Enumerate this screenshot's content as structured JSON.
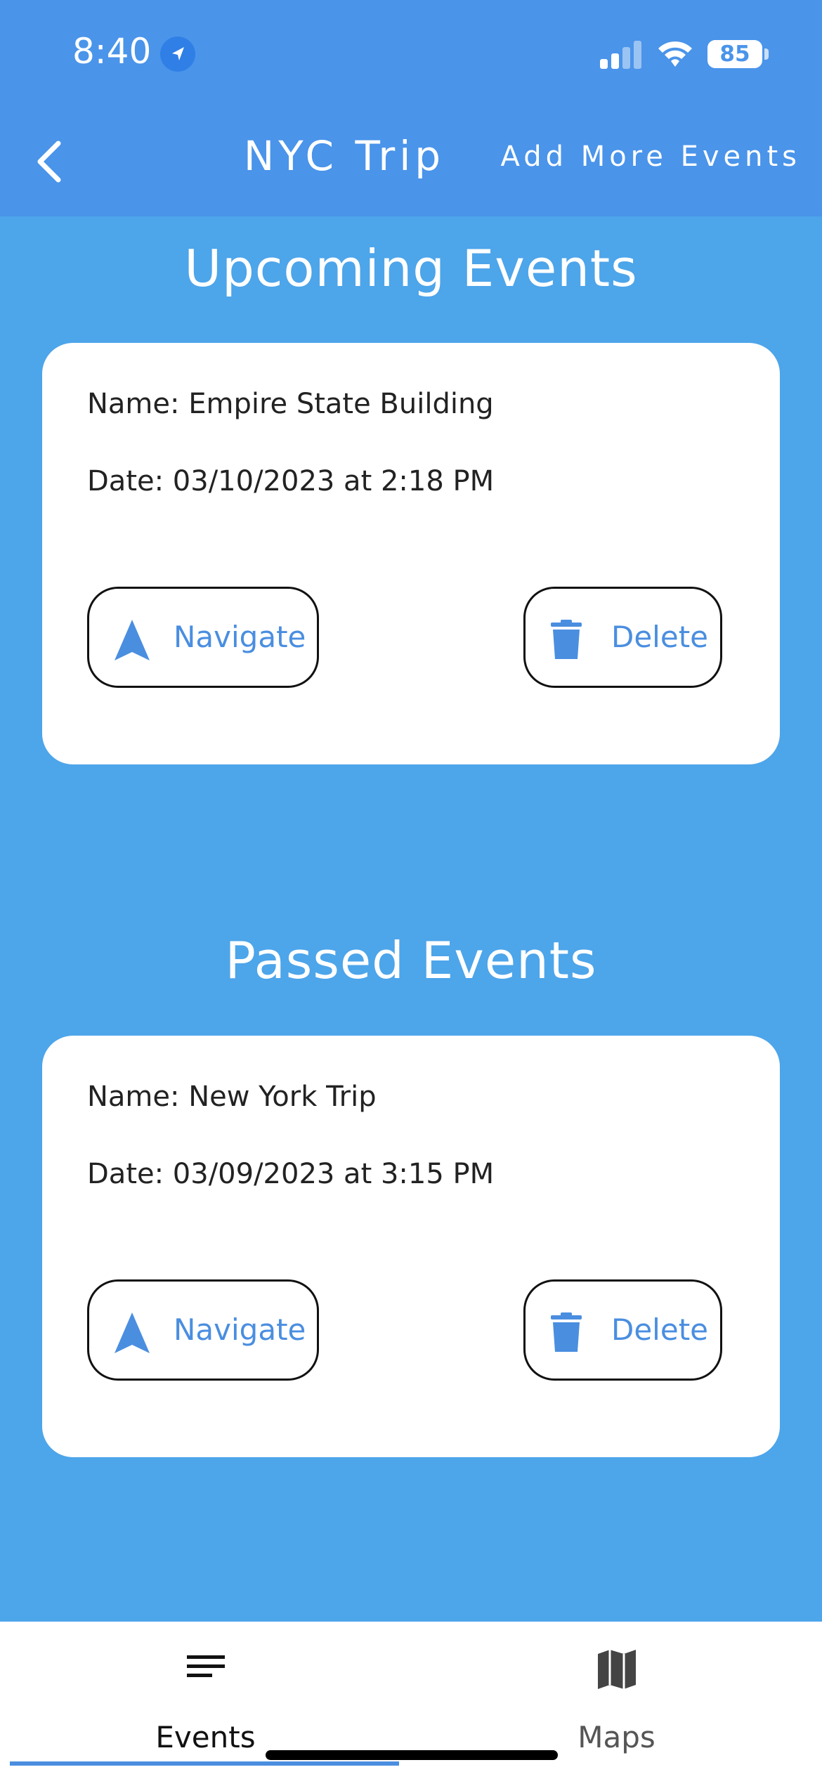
{
  "status_bar": {
    "time": "8:40",
    "battery": "85",
    "icons": [
      "location-arrow-icon",
      "cellular-signal-icon",
      "wifi-icon",
      "battery-icon"
    ]
  },
  "nav": {
    "back_icon": "chevron-left-icon",
    "title": "NYC Trip",
    "add_more_label": "Add More Events"
  },
  "sections": {
    "upcoming": {
      "title": "Upcoming Events",
      "event": {
        "name_line": "Name: Empire State Building",
        "date_line": "Date: 03/10/2023 at 2:18 PM",
        "navigate_label": "Navigate",
        "delete_label": "Delete"
      }
    },
    "passed": {
      "title": "Passed Events",
      "event": {
        "name_line": "Name: New York Trip",
        "date_line": "Date: 03/09/2023 at 3:15 PM",
        "navigate_label": "Navigate",
        "delete_label": "Delete"
      }
    }
  },
  "tabs": [
    {
      "label": "Events",
      "icon": "list-icon",
      "selected": true
    },
    {
      "label": "Maps",
      "icon": "map-icon",
      "selected": false
    }
  ],
  "colors": {
    "header": "#4a94ea",
    "background": "#4da5ea",
    "accent": "#4a8ee0",
    "card": "#ffffff"
  }
}
